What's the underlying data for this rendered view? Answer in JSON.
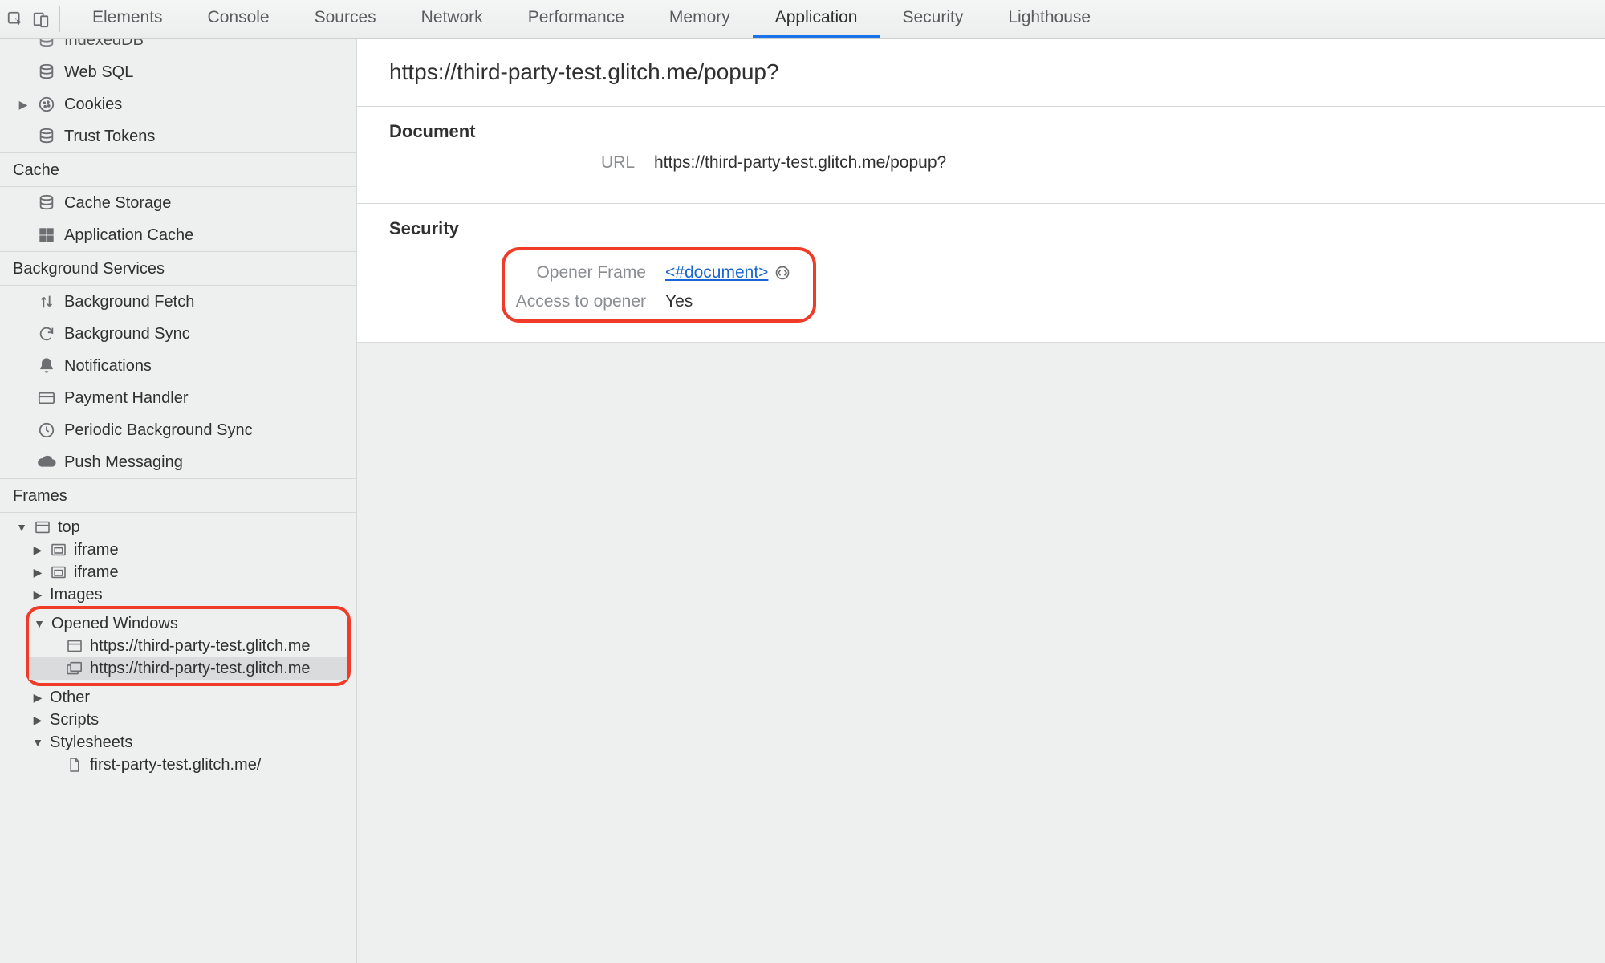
{
  "tabs": [
    "Elements",
    "Console",
    "Sources",
    "Network",
    "Performance",
    "Memory",
    "Application",
    "Security",
    "Lighthouse"
  ],
  "activeTab": "Application",
  "sidebar": {
    "storage_items": [
      {
        "label": "IndexedDB",
        "icon": "database"
      },
      {
        "label": "Web SQL",
        "icon": "database"
      },
      {
        "label": "Cookies",
        "icon": "cookie",
        "expandable": true
      },
      {
        "label": "Trust Tokens",
        "icon": "database"
      }
    ],
    "groups": [
      {
        "title": "Cache",
        "items": [
          {
            "label": "Cache Storage",
            "icon": "database"
          },
          {
            "label": "Application Cache",
            "icon": "grid"
          }
        ]
      },
      {
        "title": "Background Services",
        "items": [
          {
            "label": "Background Fetch",
            "icon": "updown"
          },
          {
            "label": "Background Sync",
            "icon": "sync"
          },
          {
            "label": "Notifications",
            "icon": "bell"
          },
          {
            "label": "Payment Handler",
            "icon": "card"
          },
          {
            "label": "Periodic Background Sync",
            "icon": "clock"
          },
          {
            "label": "Push Messaging",
            "icon": "cloud"
          }
        ]
      }
    ],
    "frames_title": "Frames",
    "frames": {
      "top": "top",
      "iframe": "iframe",
      "images": "Images",
      "opened": "Opened Windows",
      "ow1": "https://third-party-test.glitch.me",
      "ow2": "https://third-party-test.glitch.me",
      "other": "Other",
      "scripts": "Scripts",
      "stylesheets": "Stylesheets",
      "leaf": "first-party-test.glitch.me/"
    }
  },
  "main": {
    "title": "https://third-party-test.glitch.me/popup?",
    "doc": {
      "heading": "Document",
      "url_label": "URL",
      "url": "https://third-party-test.glitch.me/popup?"
    },
    "security": {
      "heading": "Security",
      "opener_frame_label": "Opener Frame",
      "opener_frame_value": "<#document>",
      "access_label": "Access to opener",
      "access_value": "Yes"
    }
  }
}
